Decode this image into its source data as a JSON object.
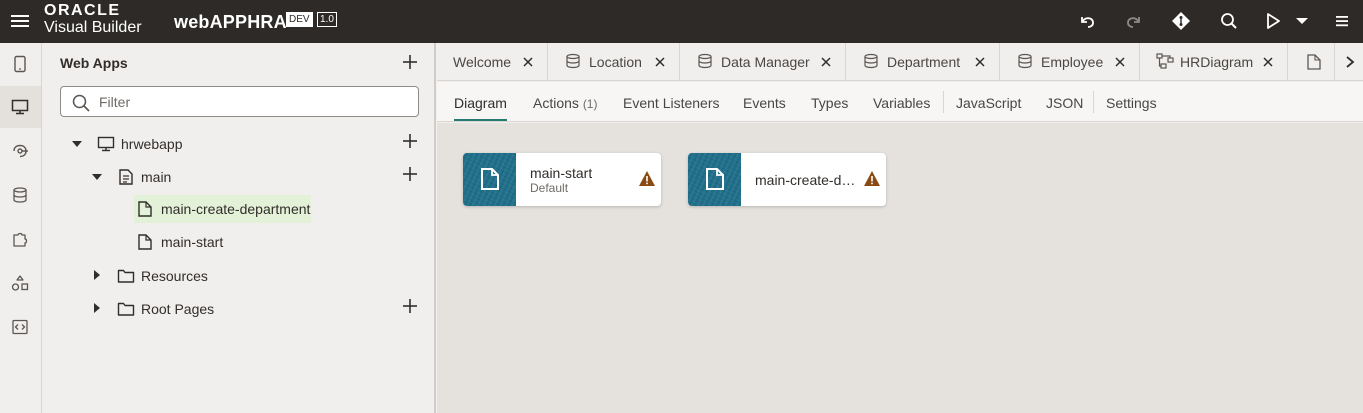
{
  "header": {
    "brand_top": "ORACLE",
    "brand_bottom": "Visual Builder",
    "app_name": "webAPPHRA",
    "env_badge": "DEV",
    "version_badge": "1.0",
    "icons": [
      "hamburger-menu-icon",
      "undo-icon",
      "redo-icon",
      "git-icon",
      "search-icon",
      "run-icon",
      "chevron-down-icon",
      "overflow-menu-icon"
    ]
  },
  "rail": {
    "items": [
      "mobile-apps-icon",
      "web-apps-icon",
      "services-icon",
      "business-objects-icon",
      "components-icon",
      "processes-icon",
      "source-icon"
    ],
    "active_index": 1
  },
  "navigator": {
    "title": "Web Apps",
    "filter_placeholder": "Filter",
    "tree": {
      "app": "hrwebapp",
      "flow": "main",
      "pages": [
        "main-create-department",
        "main-start"
      ],
      "resources": "Resources",
      "root_pages": "Root Pages",
      "selected": "main-create-department"
    }
  },
  "tabs": [
    {
      "label": "Welcome",
      "icon": ""
    },
    {
      "label": "Location",
      "icon": "database-icon"
    },
    {
      "label": "Data Manager",
      "icon": "database-icon"
    },
    {
      "label": "Department",
      "icon": "database-icon"
    },
    {
      "label": "Employee",
      "icon": "database-icon"
    },
    {
      "label": "HRDiagram",
      "icon": "diagram-icon"
    },
    {
      "label": "",
      "icon": "page-icon"
    }
  ],
  "subtabs": {
    "items": [
      "Diagram",
      "Actions",
      "Event Listeners",
      "Events",
      "Types",
      "Variables",
      "JavaScript",
      "JSON",
      "Settings"
    ],
    "actions_count": "(1)",
    "active": "Diagram"
  },
  "diagram": {
    "cards": [
      {
        "title": "main-start",
        "subtitle": "Default",
        "status_icon": "warning-icon"
      },
      {
        "title": "main-create-department",
        "subtitle": "",
        "status_icon": "warning-icon"
      }
    ]
  },
  "colors": {
    "header_bg": "#2e2a27",
    "accent": "#277a6f",
    "card_thumb": "#1f6f8b",
    "warning": "#8a4b12",
    "selected_row": "#e3f1d8"
  }
}
